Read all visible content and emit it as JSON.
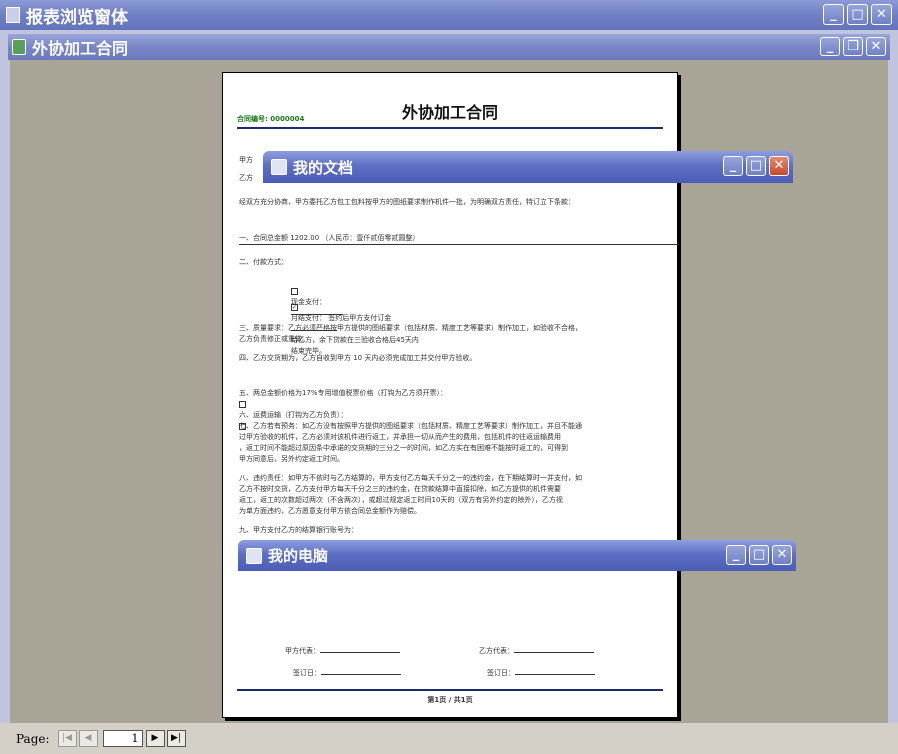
{
  "app": {
    "outer_title": "报表浏览窗体",
    "inner_title": "外协加工合同"
  },
  "window_buttons": {
    "minimize": "_",
    "maximize": "□",
    "restore": "❐",
    "close": "✕"
  },
  "document": {
    "title": "外协加工合同",
    "contract_no": "合同编号: 0000004",
    "party_a": "甲方",
    "party_b": "乙方",
    "intro": "经双方充分协商，甲方委托乙方包工包料按甲方的图纸要求制作机件一批，为明确双方责任，特订立下条款：",
    "item1": "一、合同总金额  1202.00 （人民币：壹仟贰佰零贰圆整）",
    "item2": "二、付款方式：",
    "item2_cash": "现金支付：",
    "item2_transfer": "月结支付： 签约后甲方支付订金",
    "item2_transfer_rest": "给乙方，余下贷款在三验收合格后45天内\n结束完毕。",
    "item3": "三、质量要求：乙方必须严格按甲方提供的图纸要求（包括材质、精度工艺等要求）制作加工，如验收不合格，\n乙方负责修正或重做。",
    "item4": "四、乙方交货期为，乙方自收到甲方   10   天内必须完成加工并交付甲方验收。",
    "item5": "五、两总金额价格为17%专用增值税票价格（打钩为乙方须开票）：",
    "item6": "六、运费运输（打钩为乙方负责）：",
    "item7": "七、乙方若有预务：如乙方没有按照甲方提供的图纸要求（包括材质、精度工艺等要求）制作加工，并且不能通\n过甲方验收的机件，乙方必须对该机件进行返工，并承担一切从而产生的费用，包括机件的往返运输费用\n，返工时间不能超过原因条中承诺的交货期的三分之一的时间，如乙方实在有困难不能按时返工的，可得到\n甲方同意后，另外约定返工时间。",
    "item8": "八、违约责任：如甲方不依时与乙方结算的，甲方支付乙方每天千分之一的违约金，在下期结算时一并支付，如\n乙方不按时交货，乙方支付甲方每天千分之三的违约金，在贷款结算中直接扣除，如乙方提供的机件需要\n返工，返工的次数超过两次（不含两次），或超过规定返工时间10天的（双方有另外约定的除外），乙方视\n为单方面违约，乙方愿意支付甲方依合同总金额作为赔偿。",
    "item9": "九、甲方支付乙方的结算银行账号为：",
    "sign_a": "甲方代表：",
    "sign_b": "乙方代表：",
    "date_a": "签订日：",
    "date_b": "签订日：",
    "footer": "第1页 / 共1页"
  },
  "floating_windows": [
    {
      "title": "我的文档",
      "icon": "folder-icon"
    },
    {
      "title": "我的电脑",
      "icon": "computer-icon"
    }
  ],
  "status_bar": {
    "page_label": "Page:",
    "page_value": "1",
    "first": "|◀",
    "prev": "◀",
    "next": "▶",
    "last": "▶|"
  }
}
